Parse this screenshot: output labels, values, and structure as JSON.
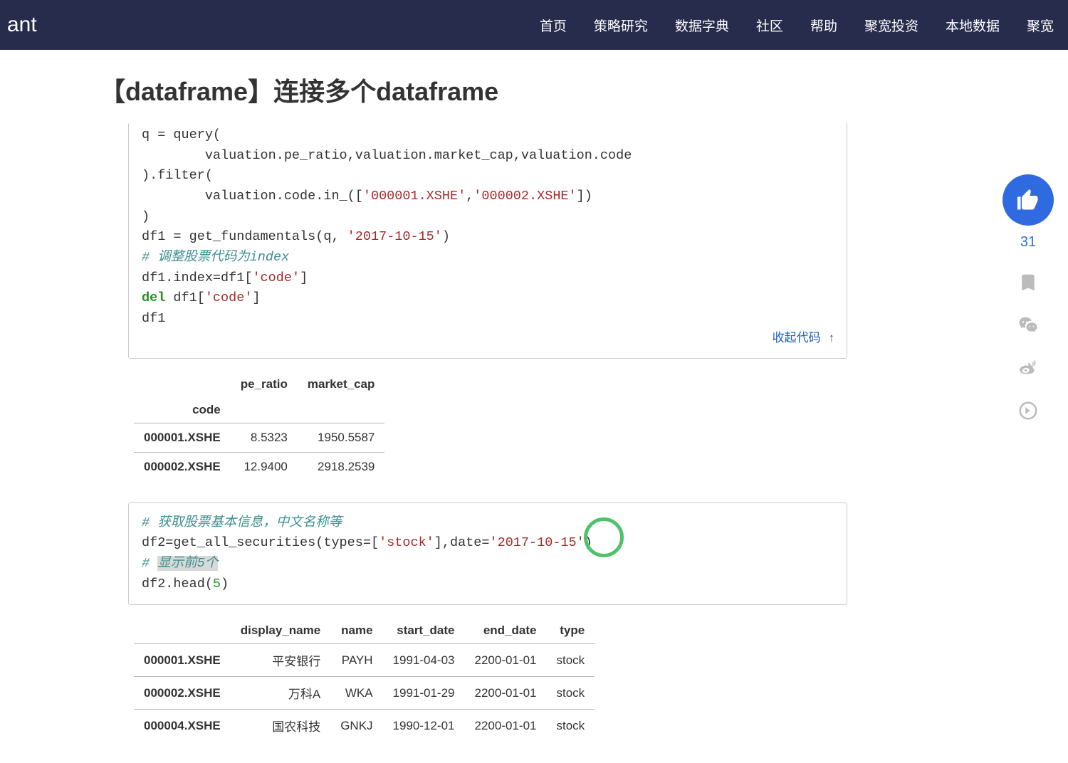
{
  "nav": {
    "logo_fragment": "ant",
    "items": [
      "首页",
      "策略研究",
      "数据字典",
      "社区",
      "帮助",
      "聚宽投资",
      "本地数据",
      "聚宽"
    ]
  },
  "page_title": "【dataframe】连接多个dataframe",
  "code1": {
    "line1a": "q = query(",
    "line2a": "        valuation.pe_ratio,valuation.market_cap,valuation.code",
    "line3a": ").filter(",
    "line4_pre": "        valuation.code.in_([",
    "line4_s1": "'000001.XSHE'",
    "line4_mid": ",",
    "line4_s2": "'000002.XSHE'",
    "line4_post": "])",
    "line5a": ")",
    "line6_pre": "df1 = get_fundamentals(q, ",
    "line6_s": "'2017-10-15'",
    "line6_post": ")",
    "line7_cm": "# 调整股票代码为index",
    "line8_pre": "df1.index=df1[",
    "line8_s": "'code'",
    "line8_post": "]",
    "line9_kw": "del",
    "line9_pre": " df1[",
    "line9_s": "'code'",
    "line9_post": "]",
    "line10": "df1",
    "collapse": "收起代码 ↑"
  },
  "table1": {
    "headers": [
      "pe_ratio",
      "market_cap"
    ],
    "index_label": "code",
    "rows": [
      {
        "idx": "000001.XSHE",
        "pe_ratio": "8.5323",
        "market_cap": "1950.5587"
      },
      {
        "idx": "000002.XSHE",
        "pe_ratio": "12.9400",
        "market_cap": "2918.2539"
      }
    ]
  },
  "code2": {
    "line1_cm": "# 获取股票基本信息，中文名称等",
    "line2_pre": "df2=get_all_securities(types=[",
    "line2_s1": "'stock'",
    "line2_mid": "],date=",
    "line2_s2": "'2017-10-15'",
    "line2_post": ")",
    "line3_cm_pre": "# ",
    "line3_cm_hl": "显示前5个",
    "line4_pre": "df2.head(",
    "line4_n": "5",
    "line4_post": ")"
  },
  "table2": {
    "headers": [
      "display_name",
      "name",
      "start_date",
      "end_date",
      "type"
    ],
    "rows": [
      {
        "idx": "000001.XSHE",
        "display_name": "平安银行",
        "name": "PAYH",
        "start_date": "1991-04-03",
        "end_date": "2200-01-01",
        "type": "stock"
      },
      {
        "idx": "000002.XSHE",
        "display_name": "万科A",
        "name": "WKA",
        "start_date": "1991-01-29",
        "end_date": "2200-01-01",
        "type": "stock"
      },
      {
        "idx": "000004.XSHE",
        "display_name": "国农科技",
        "name": "GNKJ",
        "start_date": "1990-12-01",
        "end_date": "2200-01-01",
        "type": "stock"
      }
    ]
  },
  "sidebar": {
    "like_count": "31"
  }
}
